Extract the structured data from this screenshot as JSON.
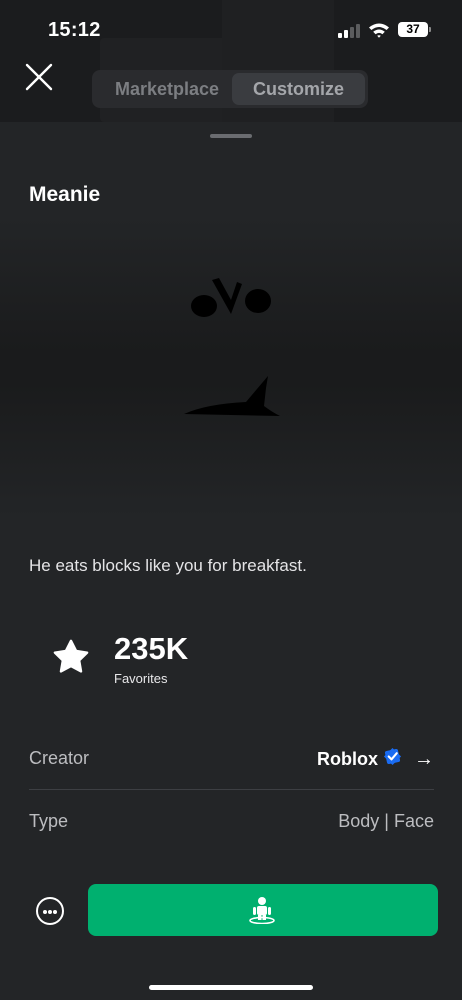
{
  "status_bar": {
    "time": "15:12",
    "battery_level": "37",
    "signal_bars_active": 2
  },
  "header": {
    "close_icon": "close-icon",
    "tabs": [
      {
        "label": "Marketplace",
        "active": false
      },
      {
        "label": "Customize",
        "active": true
      }
    ]
  },
  "item": {
    "name": "Meanie",
    "description": "He eats blocks like you for breakfast.",
    "favorites_count": "235K",
    "favorites_label": "Favorites",
    "creator_label": "Creator",
    "creator_name": "Roblox",
    "creator_verified": true,
    "type_label": "Type",
    "type_value": "Body | Face"
  },
  "actions": {
    "more_icon": "more-options-icon",
    "try_on_icon": "avatar-try-on-icon",
    "try_on_color": "#00b06f"
  },
  "colors": {
    "background": "#232527",
    "accent_green": "#00b06f",
    "verified_blue": "#1a6cf2"
  }
}
